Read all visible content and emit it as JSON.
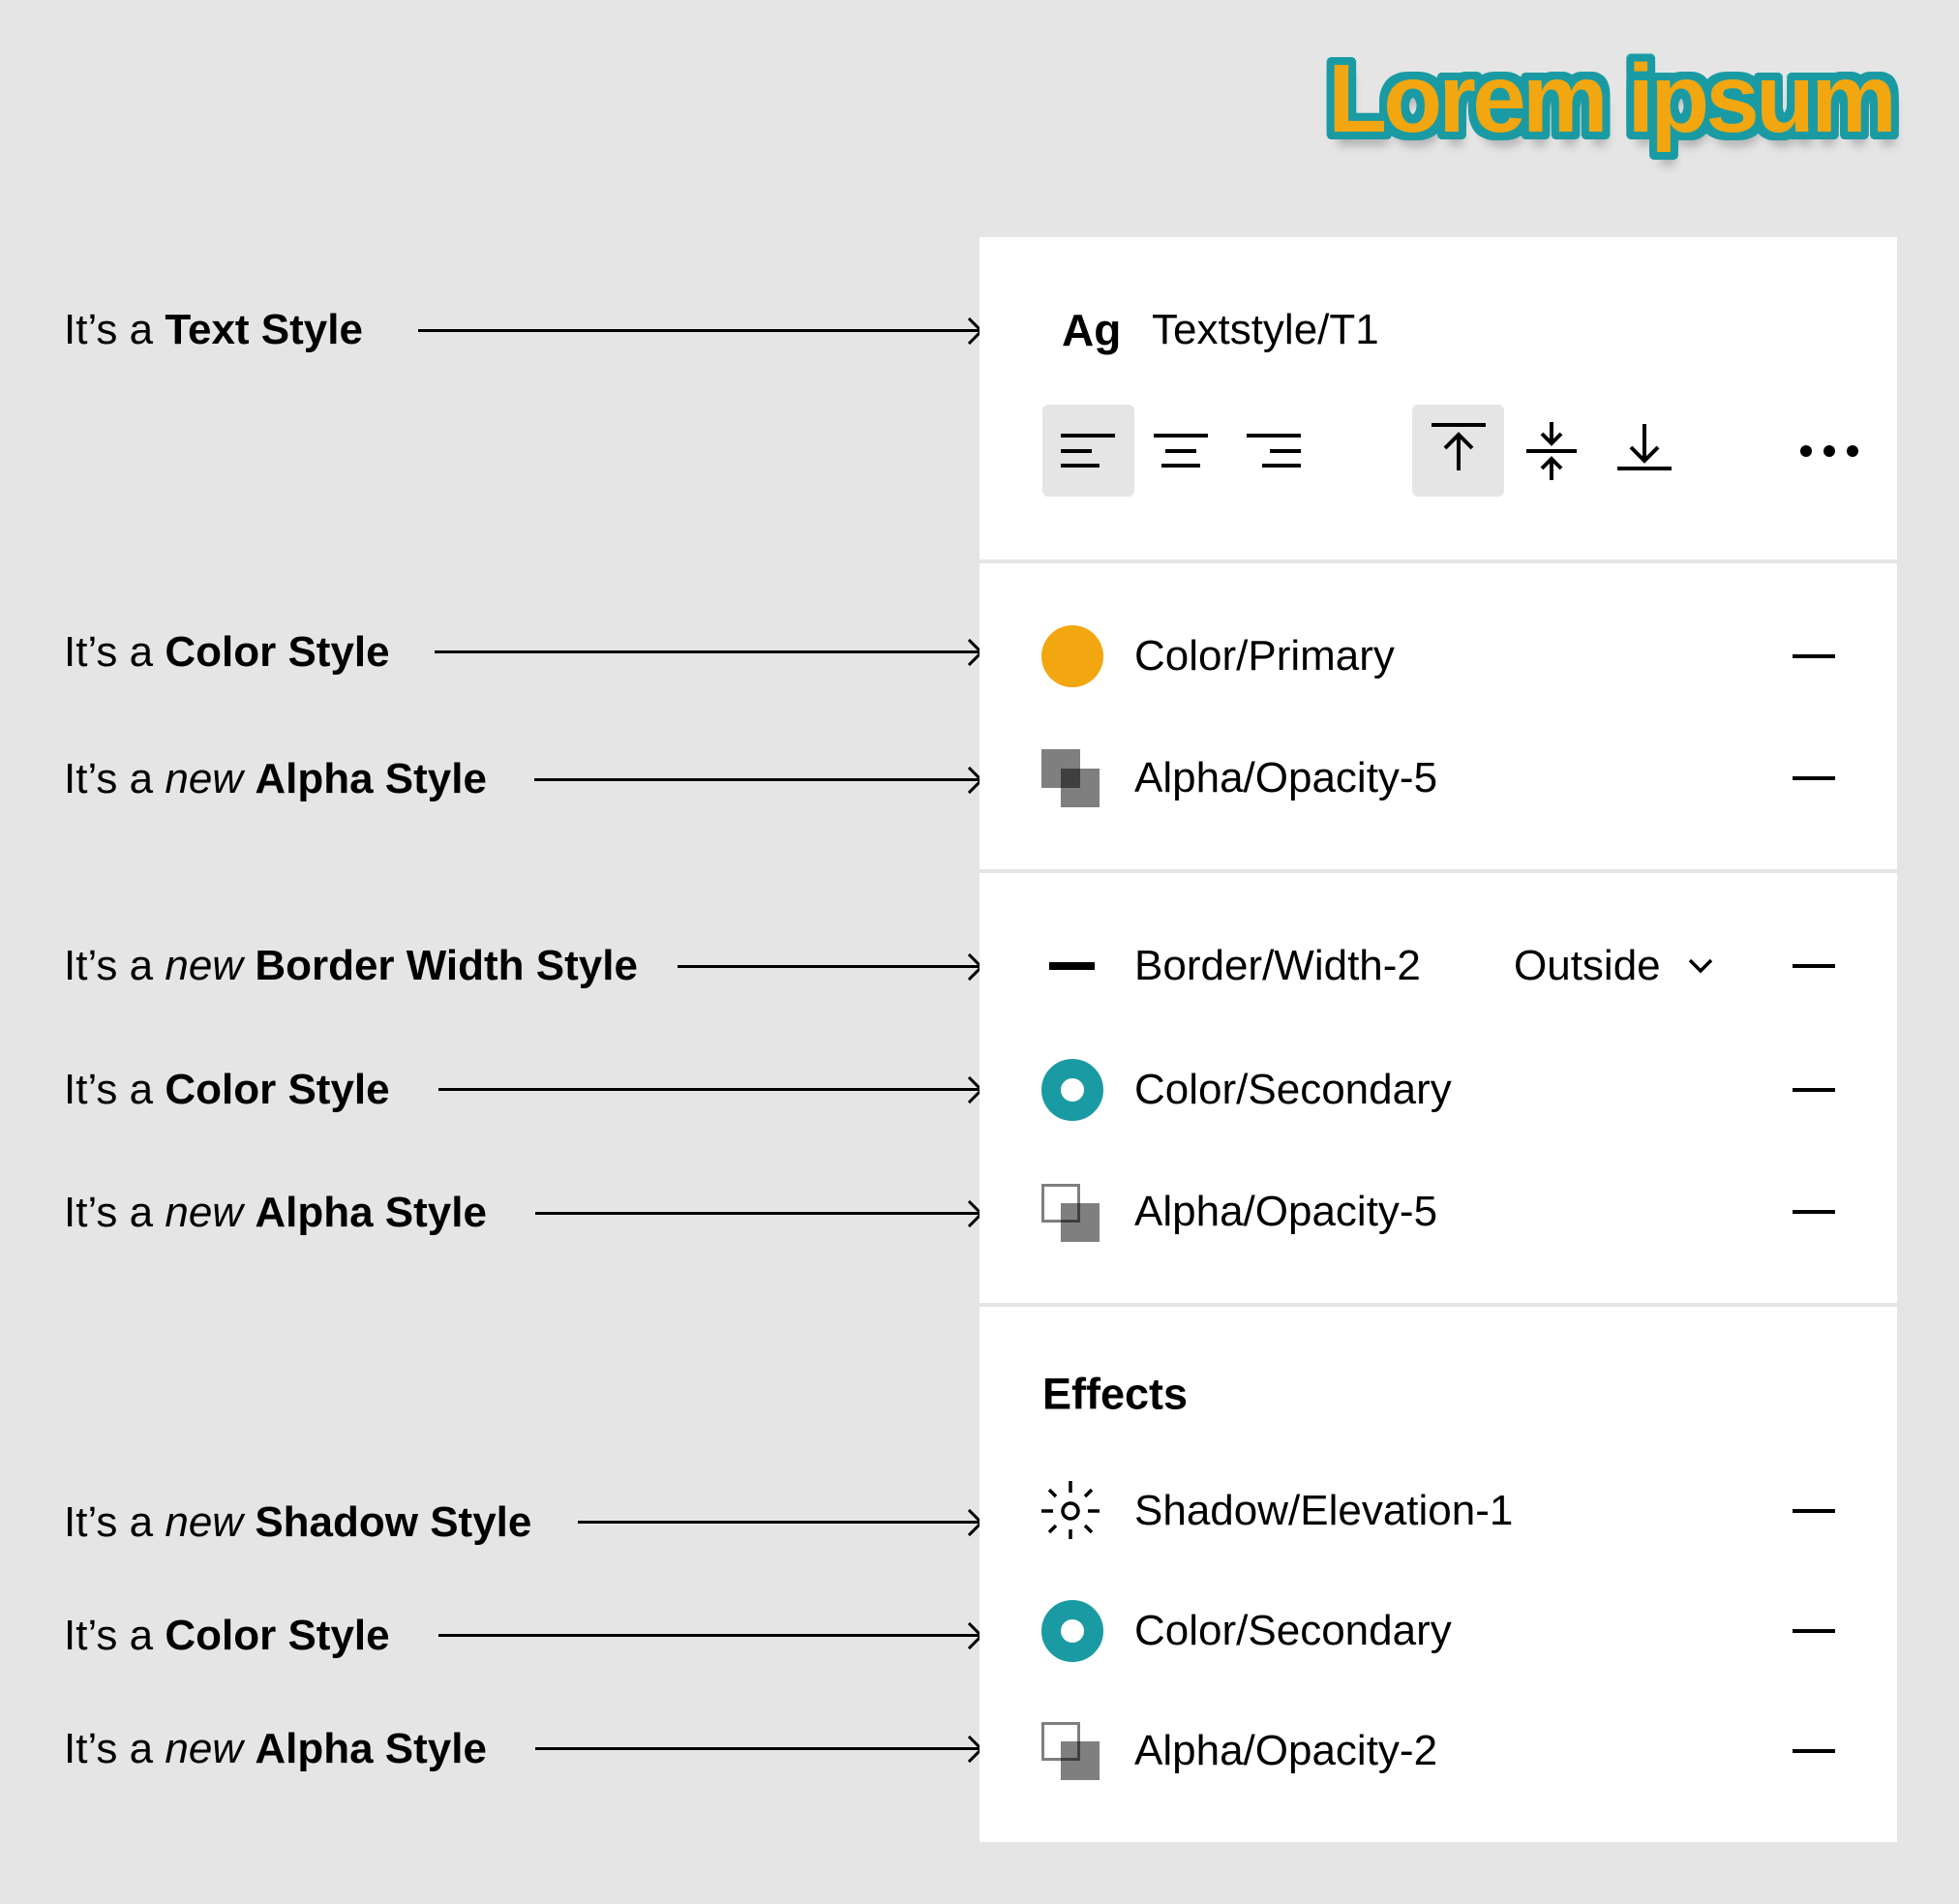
{
  "title": "Lorem ipsum",
  "colors": {
    "background": "#e5e5e5",
    "panel": "#ffffff",
    "primary": "#f2a60f",
    "secondary": "#1a9ba3",
    "alpha_gray": "#808080"
  },
  "annotations": [
    {
      "prefix": "It’s a ",
      "new": "",
      "bold": "Text Style"
    },
    {
      "prefix": "It’s a ",
      "new": "",
      "bold": "Color Style"
    },
    {
      "prefix": "It’s a ",
      "new": "new",
      "bold": "Alpha Style"
    },
    {
      "prefix": "It’s a ",
      "new": "new",
      "bold": "Border Width Style"
    },
    {
      "prefix": "It’s a ",
      "new": "",
      "bold": "Color Style"
    },
    {
      "prefix": "It’s a ",
      "new": "new",
      "bold": "Alpha Style"
    },
    {
      "prefix": "It’s a ",
      "new": "new",
      "bold": "Shadow Style"
    },
    {
      "prefix": "It’s a ",
      "new": "",
      "bold": "Color Style"
    },
    {
      "prefix": "It’s a ",
      "new": "new",
      "bold": "Alpha Style"
    }
  ],
  "panel": {
    "text_section": {
      "glyph": "Ag",
      "style_name": "Textstyle/T1",
      "align_buttons": [
        {
          "icon": "align-left-icon",
          "active": true
        },
        {
          "icon": "align-center-icon",
          "active": false
        },
        {
          "icon": "align-right-icon",
          "active": false
        }
      ],
      "valign_buttons": [
        {
          "icon": "align-top-icon",
          "active": true
        },
        {
          "icon": "align-middle-icon",
          "active": false
        },
        {
          "icon": "align-bottom-icon",
          "active": false
        }
      ],
      "more_icon": "more-horizontal-icon"
    },
    "fill_section": {
      "rows": [
        {
          "icon": "color-swatch-filled",
          "label": "Color/Primary",
          "remove_icon": "minus-icon"
        },
        {
          "icon": "alpha-icon",
          "label": "Alpha/Opacity-5",
          "remove_icon": "minus-icon"
        }
      ]
    },
    "stroke_section": {
      "rows": [
        {
          "icon": "border-width-icon",
          "label": "Border/Width-2",
          "position": "Outside",
          "remove_icon": "minus-icon"
        },
        {
          "icon": "color-swatch-ring",
          "label": "Color/Secondary",
          "remove_icon": "minus-icon"
        },
        {
          "icon": "alpha-outline-icon",
          "label": "Alpha/Opacity-5",
          "remove_icon": "minus-icon"
        }
      ]
    },
    "effects_section": {
      "heading": "Effects",
      "rows": [
        {
          "icon": "shadow-icon",
          "label": "Shadow/Elevation-1",
          "remove_icon": "minus-icon"
        },
        {
          "icon": "color-swatch-ring",
          "label": "Color/Secondary",
          "remove_icon": "minus-icon"
        },
        {
          "icon": "alpha-outline-icon",
          "label": "Alpha/Opacity-2",
          "remove_icon": "minus-icon"
        }
      ]
    }
  }
}
